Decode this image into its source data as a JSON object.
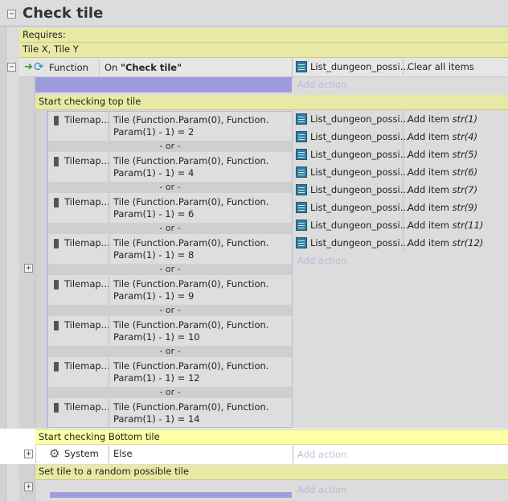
{
  "group": {
    "title": "Check tile",
    "requires_label": "Requires:",
    "params": "Tile X, Tile Y"
  },
  "function_event": {
    "object": "Function",
    "trigger_prefix": "On ",
    "trigger_name": "\"Check tile\"",
    "action_object": "List_dungeon_possi...",
    "action": "Clear all items",
    "add_action": "Add action"
  },
  "top_group": {
    "title": "Start checking top tile",
    "conditions": [
      {
        "object": "Tilemap...",
        "line1": "Tile (Function.Param(0), Function.",
        "line2": "Param(1) - 1) = 2"
      },
      {
        "object": "Tilemap...",
        "line1": "Tile (Function.Param(0), Function.",
        "line2": "Param(1) - 1) = 4"
      },
      {
        "object": "Tilemap...",
        "line1": "Tile (Function.Param(0), Function.",
        "line2": "Param(1) - 1) = 6"
      },
      {
        "object": "Tilemap...",
        "line1": "Tile (Function.Param(0), Function.",
        "line2": "Param(1) - 1) = 8"
      },
      {
        "object": "Tilemap...",
        "line1": "Tile (Function.Param(0), Function.",
        "line2": "Param(1) - 1) = 9"
      },
      {
        "object": "Tilemap...",
        "line1": "Tile (Function.Param(0), Function.",
        "line2": "Param(1) - 1) = 10"
      },
      {
        "object": "Tilemap...",
        "line1": "Tile (Function.Param(0), Function.",
        "line2": "Param(1) - 1) = 12"
      },
      {
        "object": "Tilemap...",
        "line1": "Tile (Function.Param(0), Function.",
        "line2": "Param(1) - 1) = 14"
      }
    ],
    "or_label": "- or -",
    "actions": [
      {
        "object": "List_dungeon_possi...",
        "verb": "Add item ",
        "arg": "str(1)"
      },
      {
        "object": "List_dungeon_possi...",
        "verb": "Add item ",
        "arg": "str(4)"
      },
      {
        "object": "List_dungeon_possi...",
        "verb": "Add item ",
        "arg": "str(5)"
      },
      {
        "object": "List_dungeon_possi...",
        "verb": "Add item ",
        "arg": "str(6)"
      },
      {
        "object": "List_dungeon_possi...",
        "verb": "Add item ",
        "arg": "str(7)"
      },
      {
        "object": "List_dungeon_possi...",
        "verb": "Add item ",
        "arg": "str(9)"
      },
      {
        "object": "List_dungeon_possi...",
        "verb": "Add item ",
        "arg": "str(11)"
      },
      {
        "object": "List_dungeon_possi...",
        "verb": "Add item ",
        "arg": "str(12)"
      }
    ],
    "add_action": "Add action"
  },
  "bottom_group": {
    "title": "Start checking Bottom tile",
    "condition_object": "System",
    "condition": "Else",
    "add_action": "Add action"
  },
  "random_group": {
    "title": "Set tile to a random possible tile",
    "add_action": "Add action"
  }
}
